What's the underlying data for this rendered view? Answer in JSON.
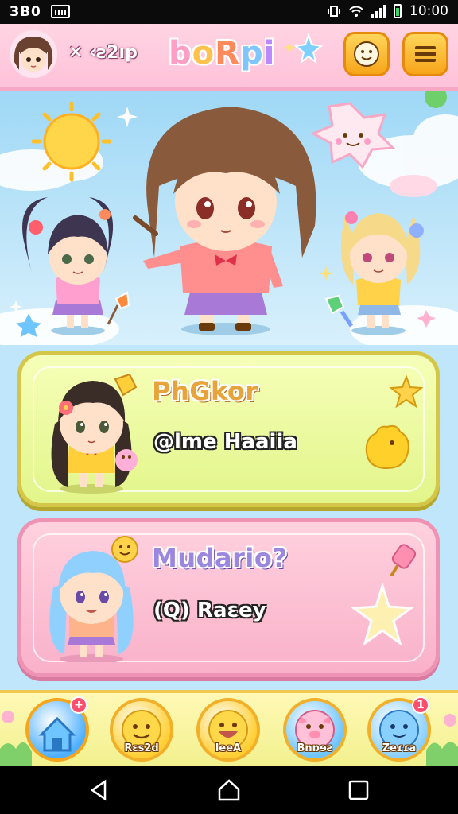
{
  "status_bar": {
    "left_text": "ЗВ0",
    "time": "10:00"
  },
  "header": {
    "brand_small": "✕ ‹ƨ2ıp",
    "brand": [
      "b",
      "o",
      "R",
      "p",
      "i"
    ],
    "brand_colors": [
      "#ff9fc6",
      "#ffc24d",
      "#ff8a5c",
      "#7fc6ff",
      "#b889ff"
    ]
  },
  "cards": [
    {
      "title": "PhGkor",
      "subtitle": "@lme Haaiia"
    },
    {
      "title": "Mudario?",
      "subtitle": "(Q) Raɛey"
    }
  ],
  "bottom_nav": [
    {
      "label": "",
      "badge": "+",
      "icon": "house-icon",
      "color": "#4fb0ff"
    },
    {
      "label": "Rεs2d",
      "badge": "",
      "icon": "smiley-icon",
      "color": "#ffcf33"
    },
    {
      "label": "leeA",
      "badge": "",
      "icon": "grin-icon",
      "color": "#ffcf33"
    },
    {
      "label": "Bnɒɘƨ",
      "badge": "",
      "icon": "pig-face-icon",
      "color": "#6fc5ff"
    },
    {
      "label": "Zeɾɾa",
      "badge": "1",
      "icon": "blob-face-icon",
      "color": "#8ad0ff"
    }
  ]
}
